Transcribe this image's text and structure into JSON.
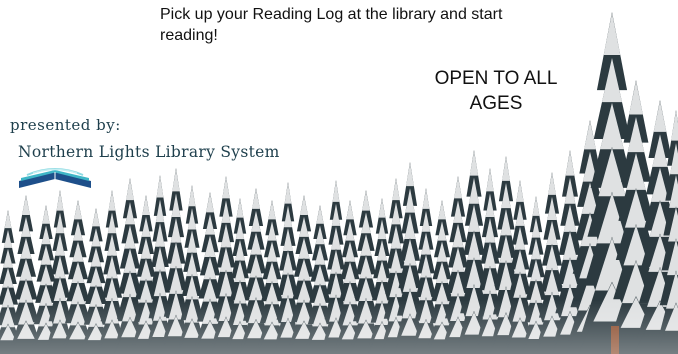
{
  "poster": {
    "pickup_text": "Pick up your Reading Log at the library and start reading!",
    "open_text": "OPEN TO ALL AGES",
    "presented_by": "presented by:",
    "library_name": "Northern Lights Library System"
  },
  "icons": {
    "logo": "open-book-aurora-icon",
    "background": "snowy-forest-illustration"
  },
  "colors": {
    "text": "#111111",
    "library_text": "#1e3f4c",
    "logo_teal": "#3fb6c7",
    "logo_navy": "#1d4f8a",
    "trees": "#2c3a40",
    "snow": "#ffffff"
  }
}
